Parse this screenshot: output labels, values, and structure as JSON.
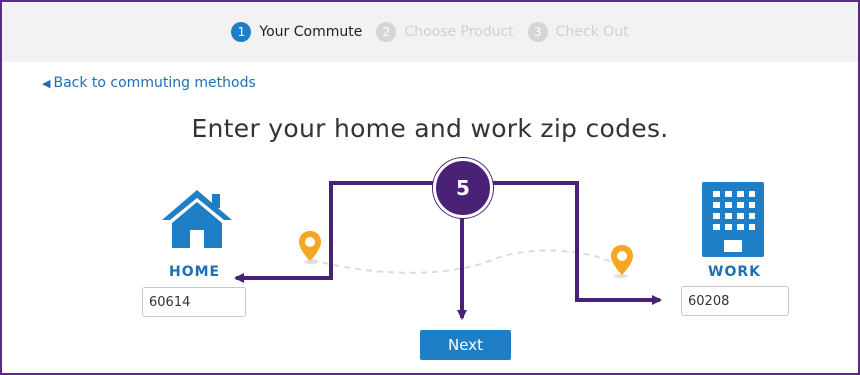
{
  "steps": [
    {
      "number": "1",
      "label": "Your Commute",
      "active": true
    },
    {
      "number": "2",
      "label": "Choose Product",
      "active": false
    },
    {
      "number": "3",
      "label": "Check Out",
      "active": false
    }
  ],
  "back_link": {
    "caret": "◀",
    "label": "Back to commuting methods"
  },
  "heading": "Enter your home and work zip codes.",
  "home": {
    "label": "HOME",
    "zip": "60614"
  },
  "work": {
    "label": "WORK",
    "zip": "60208"
  },
  "next_button": "Next",
  "callout": {
    "number": "5"
  },
  "colors": {
    "accent": "#1f7fc6",
    "callout": "#4a2275",
    "pin": "#f5a623",
    "frame": "#5b2a86"
  },
  "icons": [
    "home-icon",
    "office-building-icon",
    "location-pin-icon"
  ]
}
